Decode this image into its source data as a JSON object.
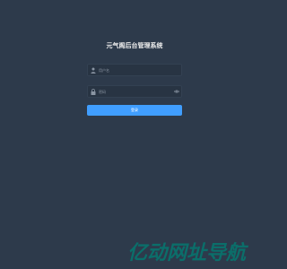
{
  "login": {
    "title": "元气阁后台管理系统",
    "username_placeholder": "用户名",
    "password_placeholder": "密码",
    "submit_label": "登录"
  },
  "icons": {
    "username": "user-icon",
    "password": "lock-icon",
    "show_password": "eye-icon"
  },
  "colors": {
    "background": "#2d3a4b",
    "input_background": "#283443",
    "primary": "#409eff",
    "watermark": "#0b6e6a"
  },
  "watermark": {
    "text": "亿动网址导航"
  }
}
